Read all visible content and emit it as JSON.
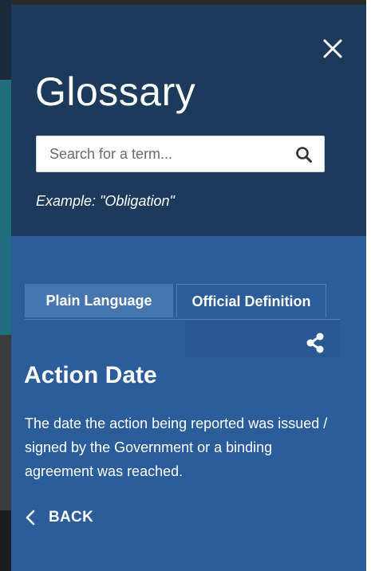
{
  "glossary": {
    "title": "Glossary",
    "close_icon": "close-icon",
    "search": {
      "placeholder": "Search for a term...",
      "value": "",
      "icon": "search-icon"
    },
    "example": "Example: \"Obligation\""
  },
  "tabs": [
    {
      "label": "Plain Language",
      "active": true
    },
    {
      "label": "Official Definition",
      "active": false
    }
  ],
  "term": {
    "share_icon": "share-icon",
    "title": "Action Date",
    "definition": "The date the action being reported was issued / signed by the Government or a binding agreement was reached."
  },
  "back": {
    "label": "BACK",
    "icon": "chevron-left-icon"
  },
  "colors": {
    "header_bg": "#1b3a5c",
    "body_bg": "#2a5d99",
    "active_tab_bg": "#4676ae",
    "text": "#ffffff"
  }
}
